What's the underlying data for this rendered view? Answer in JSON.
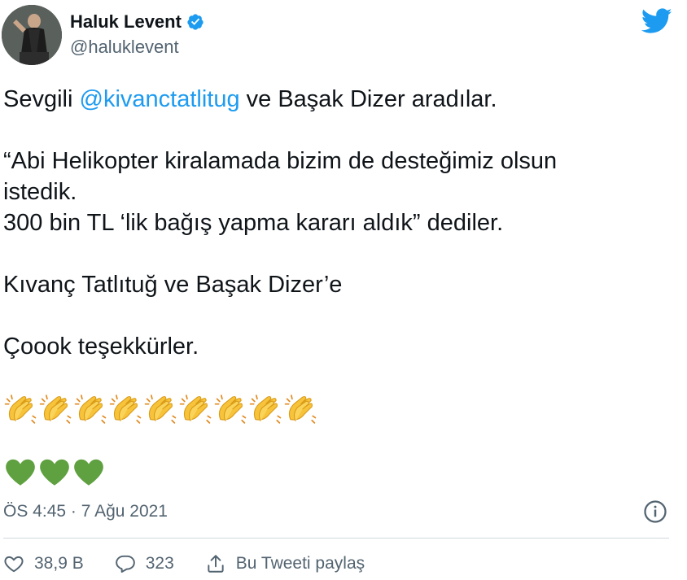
{
  "author": {
    "display_name": "Haluk Levent",
    "username": "@haluklevent"
  },
  "tweet": {
    "line1_prefix": "Sevgili ",
    "mention": "@kivanctatlitug",
    "line1_suffix": " ve Başak Dizer aradılar.",
    "line2": "“Abi Helikopter kiralamada bizim de desteğimiz olsun",
    "line3": "istedik.",
    "line4": "300 bin TL ‘lik bağış yapma kararı aldık” dediler.",
    "line5": "Kıvanç Tatlıtuğ ve Başak Dizer’e",
    "line6": "Çoook teşekkürler.",
    "clap_emoji_count": 9,
    "heart_emoji_count": 3
  },
  "timestamp": "ÖS 4:45 · 7 Ağu 2021",
  "actions": {
    "likes": "38,9 B",
    "replies": "323",
    "share_label": "Bu Tweeti paylaş"
  },
  "icons": {
    "verified": "verified-badge-icon",
    "brand": "twitter-bird-icon",
    "info": "info-icon",
    "like": "heart-outline-icon",
    "reply": "speech-bubble-icon",
    "share": "share-upload-icon"
  },
  "colors": {
    "accent": "#1d9bf0",
    "text": "#0f1419",
    "secondary": "#536471",
    "heart_emoji": "#5fa040",
    "clap_emoji": "#f7c33b"
  }
}
